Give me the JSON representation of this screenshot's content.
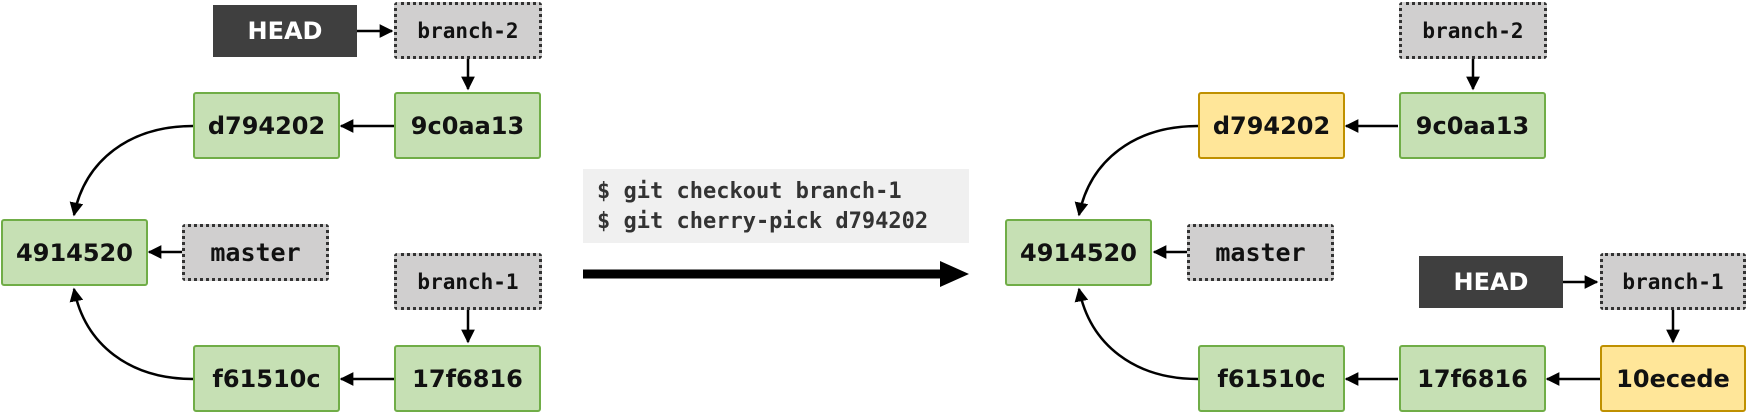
{
  "commands": [
    "$ git checkout branch-1",
    "$ git cherry-pick d794202"
  ],
  "before": {
    "head": "HEAD",
    "branch2": "branch-2",
    "branch1": "branch-1",
    "master": "master",
    "c_9c0aa13": "9c0aa13",
    "c_d794202": "d794202",
    "c_4914520": "4914520",
    "c_17f6816": "17f6816",
    "c_f61510c": "f61510c"
  },
  "after": {
    "head": "HEAD",
    "branch2": "branch-2",
    "branch1": "branch-1",
    "master": "master",
    "c_9c0aa13": "9c0aa13",
    "c_d794202": "d794202",
    "c_4914520": "4914520",
    "c_17f6816": "17f6816",
    "c_f61510c": "f61510c",
    "c_10ecede": "10ecede"
  },
  "colors": {
    "commit_fill": "#c6e0b4",
    "commit_border": "#70ad47",
    "highlight_fill": "#ffe699",
    "highlight_border": "#bf9000",
    "ref_fill": "#d0cfcf",
    "head_fill": "#3f3f3f"
  }
}
